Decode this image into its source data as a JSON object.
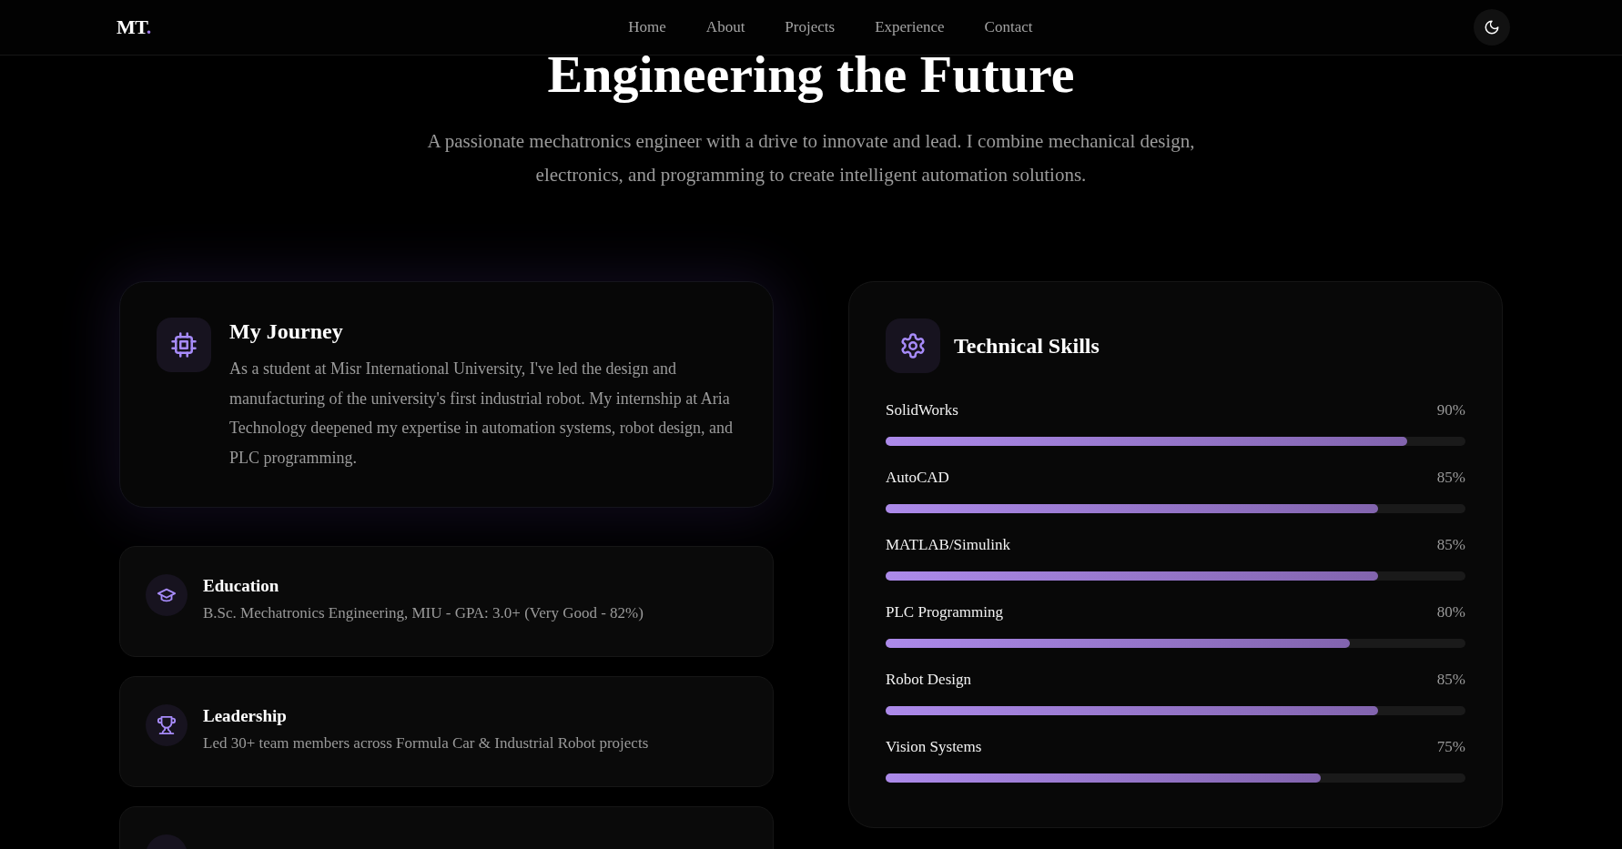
{
  "nav": {
    "logo": "MT",
    "logo_accent": ".",
    "links": [
      "Home",
      "About",
      "Projects",
      "Experience",
      "Contact"
    ]
  },
  "hero": {
    "title": "Engineering the Future",
    "subtitle": "A passionate mechatronics engineer with a drive to innovate and lead. I combine mechanical design, electronics, and programming to create intelligent automation solutions."
  },
  "journey": {
    "title": "My Journey",
    "text": "As a student at Misr International University, I've led the design and manufacturing of the university's first industrial robot. My internship at Aria Technology deepened my expertise in automation systems, robot design, and PLC programming."
  },
  "highlights": [
    {
      "kind": "education",
      "title": "Education",
      "text": "B.Sc. Mechatronics Engineering, MIU - GPA: 3.0+ (Very Good - 82%)"
    },
    {
      "kind": "leadership",
      "title": "Leadership",
      "text": "Led 30+ team members across Formula Car & Industrial Robot projects"
    },
    {
      "kind": "partial"
    }
  ],
  "skills": {
    "title": "Technical Skills",
    "items": [
      {
        "name": "SolidWorks",
        "reading": "90%",
        "level": 0.9
      },
      {
        "name": "AutoCAD",
        "reading": "85%",
        "level": 0.85
      },
      {
        "name": "MATLAB/Simulink",
        "reading": "85%",
        "level": 0.85
      },
      {
        "name": "PLC Programming",
        "reading": "80%",
        "level": 0.8
      },
      {
        "name": "Robot Design",
        "reading": "85%",
        "level": 0.85
      },
      {
        "name": "Vision Systems",
        "reading": "75%",
        "level": 0.75
      }
    ]
  }
}
